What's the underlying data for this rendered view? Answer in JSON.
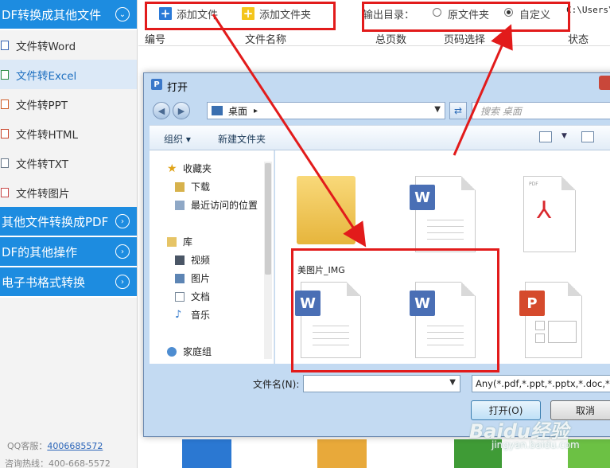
{
  "sidebar": {
    "categories": [
      {
        "label": "DF转换成其他文件",
        "chevron": "⌄"
      },
      {
        "label": "其他文件转换成PDF",
        "chevron": "›"
      },
      {
        "label": "DF的其他操作",
        "chevron": "›"
      },
      {
        "label": "电子书格式转换",
        "chevron": "›"
      }
    ],
    "items": [
      {
        "label": "文件转Word",
        "icon": "word-file-icon"
      },
      {
        "label": "文件转Excel",
        "icon": "excel-file-icon",
        "active": true
      },
      {
        "label": "文件转PPT",
        "icon": "ppt-file-icon"
      },
      {
        "label": "文件转HTML",
        "icon": "html-file-icon"
      },
      {
        "label": "文件转TXT",
        "icon": "txt-file-icon"
      },
      {
        "label": "文件转图片",
        "icon": "image-file-icon"
      }
    ],
    "qq_label": "QQ客服：",
    "qq_number": "4006685572",
    "hotline": "咨询热线：400-668-5572"
  },
  "toolbar": {
    "add_file": "添加文件",
    "add_folder": "添加文件夹",
    "output_label": "输出目录：",
    "opt_source": "原文件夹",
    "opt_custom": "自定义",
    "path": "C:\\Users\\"
  },
  "columns": [
    "编号",
    "文件名称",
    "总页数",
    "页码选择",
    "状态"
  ],
  "dialog": {
    "title": "打开",
    "address": "桌面",
    "search_placeholder": "搜索 桌面",
    "organize": "组织 ▾",
    "new_folder": "新建文件夹",
    "nav": [
      {
        "label": "收藏夹",
        "icon": "star-icon"
      },
      {
        "label": "下载",
        "icon": "download-folder-icon"
      },
      {
        "label": "最近访问的位置",
        "icon": "recent-places-icon"
      },
      {
        "label": "库",
        "icon": "library-icon"
      },
      {
        "label": "视频",
        "icon": "video-icon"
      },
      {
        "label": "图片",
        "icon": "picture-icon"
      },
      {
        "label": "文档",
        "icon": "document-icon"
      },
      {
        "label": "音乐",
        "icon": "music-icon"
      },
      {
        "label": "家庭组",
        "icon": "homegroup-icon"
      }
    ],
    "files": [
      {
        "name": "美图片_IMG",
        "type": "folder"
      },
      {
        "name": "",
        "type": "word"
      },
      {
        "name": "",
        "type": "pdf"
      },
      {
        "name": "",
        "type": "word"
      },
      {
        "name": "",
        "type": "word"
      },
      {
        "name": "",
        "type": "ppt"
      }
    ],
    "filename_label": "文件名(N):",
    "filename_value": "",
    "filetype": "Any(*.pdf,*.ppt,*.pptx,*.doc,*.",
    "open_button": "打开(O)",
    "cancel_button": "取消"
  },
  "watermark": {
    "brand": "Baidu经验",
    "url": "jingyan.baidu.com"
  },
  "colors": {
    "accent": "#1d8ce0",
    "annotation": "#e21b1b"
  }
}
